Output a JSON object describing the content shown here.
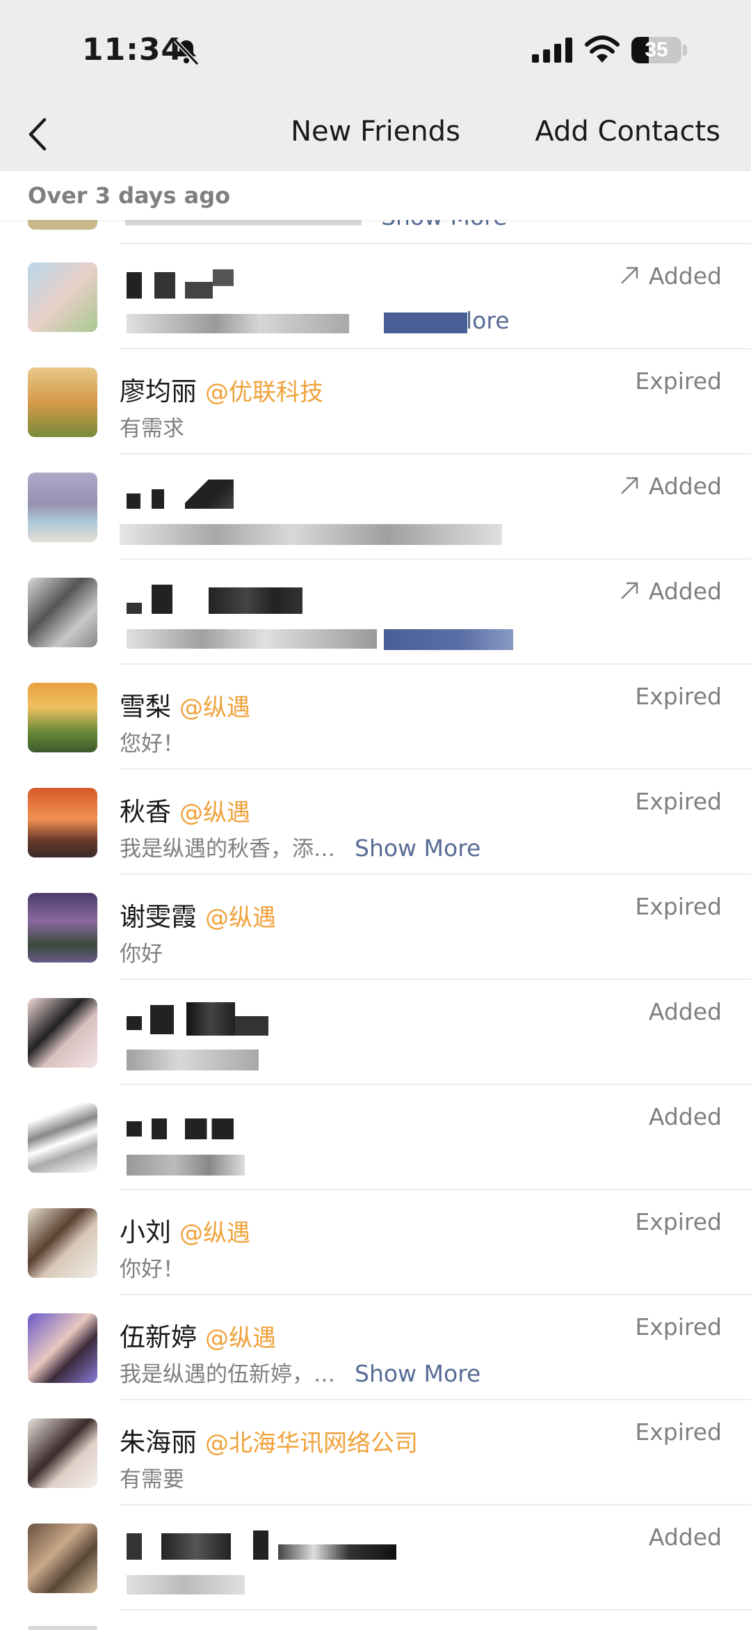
{
  "status_bar": {
    "time": "11:34",
    "battery": "35",
    "battery_level": 0.35
  },
  "nav": {
    "title": "New Friends",
    "action": "Add Contacts"
  },
  "section": {
    "header": "Over 3 days ago"
  },
  "items": [
    {
      "name": "廖均丽",
      "company": "@优联科技",
      "message": "有需求",
      "show_more": "",
      "status": "Expired"
    },
    {
      "name": "雪梨",
      "company": "@纵遇",
      "message": "您好！",
      "show_more": "",
      "status": "Expired"
    },
    {
      "name": "秋香",
      "company": "@纵遇",
      "message": "我是纵遇的秋香，添…",
      "show_more": "Show More",
      "status": "Expired"
    },
    {
      "name": "谢雯霞",
      "company": "@纵遇",
      "message": "你好",
      "show_more": "",
      "status": "Expired"
    },
    {
      "name": "小刘",
      "company": "@纵遇",
      "message": "你好！",
      "show_more": "",
      "status": "Expired"
    },
    {
      "name": "伍新婷",
      "company": "@纵遇",
      "message": "我是纵遇的伍新婷，…",
      "show_more": "Show More",
      "status": "Expired"
    },
    {
      "name": "朱海丽",
      "company": "@北海华讯网络公司",
      "message": "有需要",
      "show_more": "",
      "status": "Expired"
    }
  ],
  "blurred_items": [
    {
      "status": "Added",
      "arrow": true,
      "show_more_fragment": "lore"
    },
    {
      "status": "Added",
      "arrow": true,
      "show_more_fragment": ""
    },
    {
      "status": "Added",
      "arrow": true,
      "show_more_fragment": ""
    },
    {
      "status": "Added",
      "arrow": false,
      "show_more_fragment": ""
    },
    {
      "status": "Added",
      "arrow": false,
      "show_more_fragment": ""
    },
    {
      "status": "Added",
      "arrow": false,
      "show_more_fragment": ""
    }
  ],
  "partial_top": {
    "show_more_fragment": "Show More"
  },
  "icons": [
    "chevron-left-icon",
    "bell-slash-icon",
    "cellular-signal-icon",
    "wifi-icon",
    "battery-icon",
    "arrow-up-right-icon"
  ],
  "colors": {
    "company": "#f0a23b",
    "link": "#576b95",
    "secondary": "#7f7f7f",
    "nav_bg": "#ededed"
  }
}
